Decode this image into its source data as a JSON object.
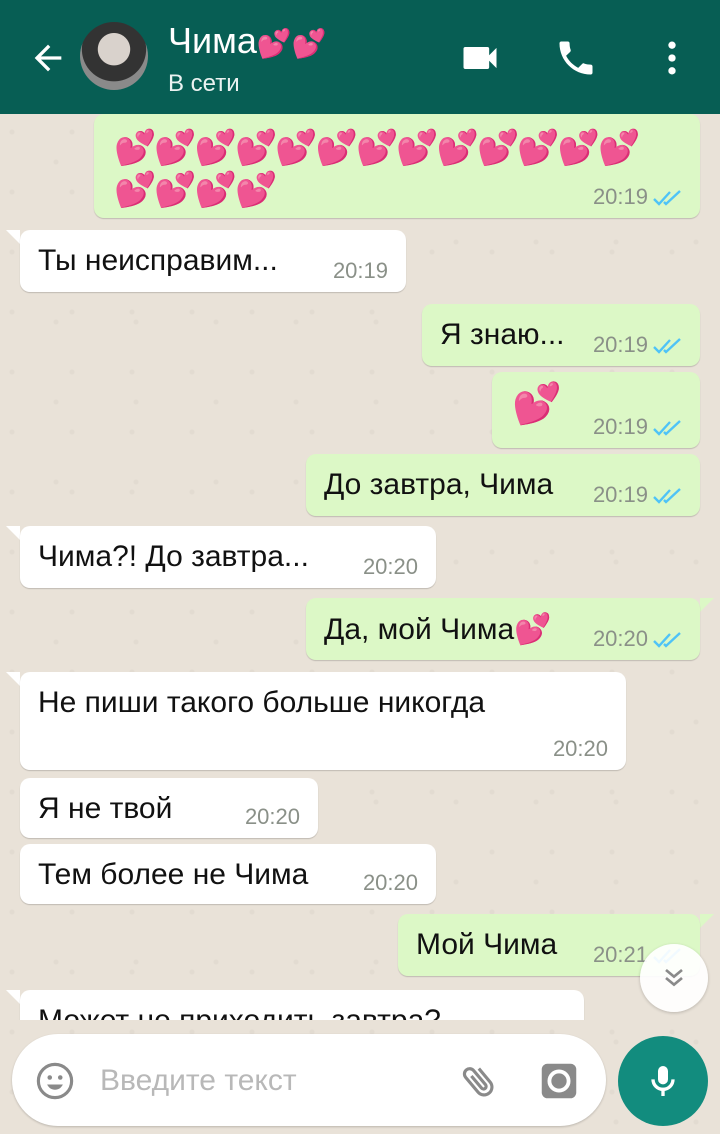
{
  "header": {
    "contact_name": "Чима",
    "name_hearts": "💕💕",
    "status": "В сети"
  },
  "messages": [
    {
      "dir": "out",
      "text": "💕💕💕💕💕💕💕💕💕💕💕💕💕",
      "text2": "💕💕💕💕",
      "time": "20:19",
      "read": true
    },
    {
      "dir": "in",
      "text": "Ты неисправим...",
      "time": "20:19"
    },
    {
      "dir": "out",
      "text": "Я знаю...",
      "time": "20:19",
      "read": true
    },
    {
      "dir": "out",
      "text": "💕",
      "time": "20:19",
      "read": true
    },
    {
      "dir": "out",
      "text": "До завтра, Чима",
      "time": "20:19",
      "read": true
    },
    {
      "dir": "in",
      "text": "Чима?! До завтра...",
      "time": "20:20"
    },
    {
      "dir": "out",
      "text": "Да, мой Чима💕",
      "time": "20:20",
      "read": true
    },
    {
      "dir": "in",
      "text": "Не пиши такого больше никогда",
      "time": "20:20"
    },
    {
      "dir": "in",
      "text": "Я не твой",
      "time": "20:20"
    },
    {
      "dir": "in",
      "text": "Тем более не Чима",
      "time": "20:20"
    },
    {
      "dir": "out",
      "text": "Мой Чима",
      "time": "20:21",
      "read": true
    },
    {
      "dir": "in",
      "text": "Может не приходить завтра?",
      "time": ""
    }
  ],
  "composer": {
    "placeholder": "Введите текст"
  },
  "colors": {
    "header": "#075e54",
    "outgoing_bubble": "#dcf8c6",
    "incoming_bubble": "#ffffff",
    "read_ticks": "#4fc3f7",
    "mic_button": "#128c7e"
  },
  "icons": [
    "back-arrow-icon",
    "video-call-icon",
    "phone-icon",
    "more-vert-icon",
    "double-check-icon",
    "emoji-icon",
    "attach-icon",
    "camera-icon",
    "mic-icon",
    "scroll-down-icon"
  ]
}
